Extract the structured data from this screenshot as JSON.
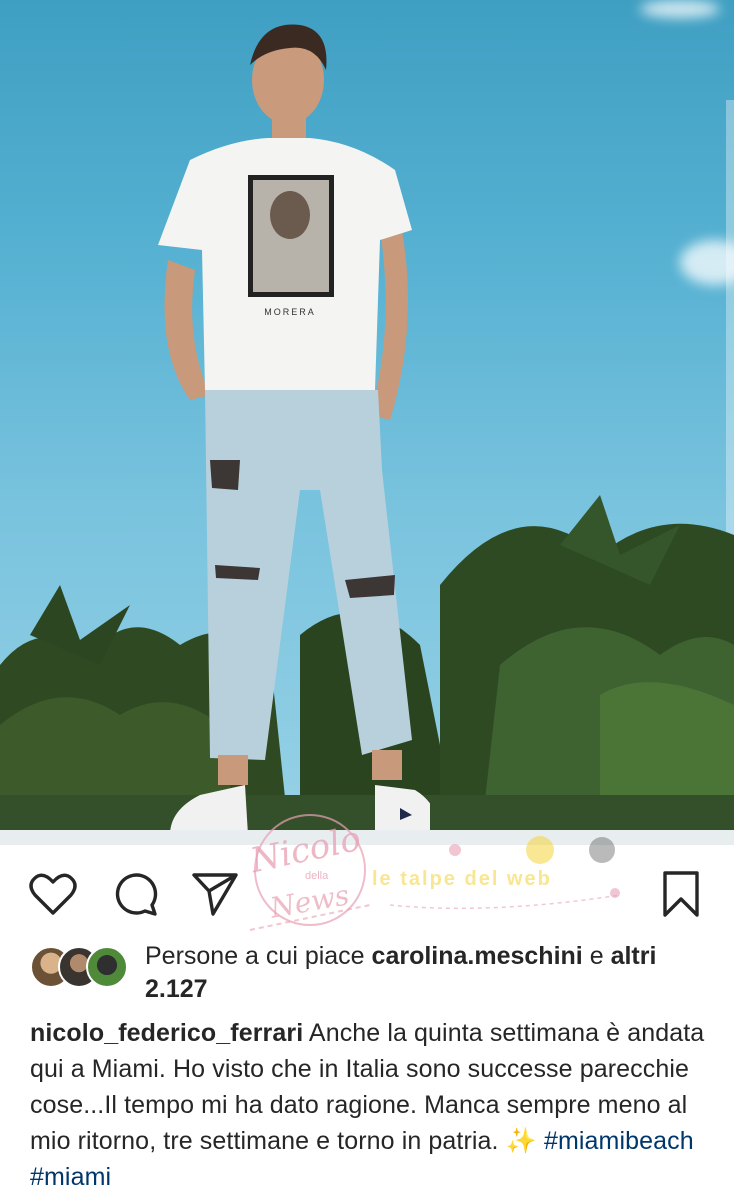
{
  "post": {
    "photo_alt": "Photo",
    "shirt_text": "MORERA"
  },
  "actions": {
    "like_icon": "heart-icon",
    "comment_icon": "comment-icon",
    "share_icon": "share-icon",
    "save_icon": "bookmark-icon"
  },
  "watermark": {
    "line1": "Nicolo",
    "line2": "della",
    "line3": "News",
    "right_text": "le talpe del web"
  },
  "likes": {
    "prefix": "Persone a cui piace",
    "user": "carolina.meschini",
    "joiner": "e",
    "others_label": "altri",
    "others_count": "2.127"
  },
  "caption": {
    "username": "nicolo_federico_ferrari",
    "text": " Anche la quinta settimana è andata qui a Miami. Ho visto che in Italia sono successe parecchie cose...Il tempo mi ha dato ragione. Manca sempre meno al mio ritorno,  tre settimane e torno in patria. ",
    "sparkle": "✨",
    "tag1": "#miamibeach",
    "tag2": "#miami"
  },
  "colors": {
    "sky": "#56b1d2",
    "text": "#262626",
    "hashtag": "#00376b",
    "watermark_pink": "#e8a0b4",
    "watermark_yellow": "#f4d33a"
  }
}
